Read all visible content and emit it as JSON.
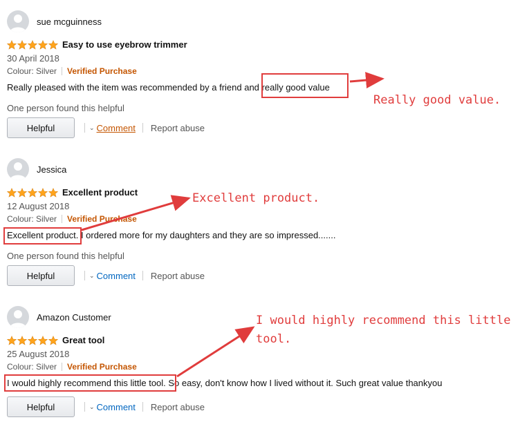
{
  "reviews": [
    {
      "reviewer": "sue mcguinness",
      "rating": 5,
      "title": "Easy to use eyebrow trimmer",
      "date": "30 April 2018",
      "colour": "Colour: Silver",
      "verified": "Verified Purchase",
      "body": "Really pleased with the item was recommended by a friend and really good value",
      "helpful_count": "One person found this helpful",
      "helpful_button": "Helpful",
      "comment": "Comment",
      "report": "Report abuse"
    },
    {
      "reviewer": "Jessica",
      "rating": 5,
      "title": "Excellent product",
      "date": "12 August 2018",
      "colour": "Colour: Silver",
      "verified": "Verified Purchase",
      "body": "Excellent product. I ordered more for my daughters and they are so impressed.......",
      "helpful_count": "One person found this helpful",
      "helpful_button": "Helpful",
      "comment": "Comment",
      "report": "Report abuse"
    },
    {
      "reviewer": "Amazon Customer",
      "rating": 5,
      "title": "Great tool",
      "date": "25 August 2018",
      "colour": "Colour: Silver",
      "verified": "Verified Purchase",
      "body": "I would highly recommend this little tool. So easy, don't know how I lived without it. Such great value thankyou",
      "helpful_count": "",
      "helpful_button": "Helpful",
      "comment": "Comment",
      "report": "Report abuse"
    }
  ],
  "annotations": {
    "a1": "Really good value.",
    "a2": "Excellent product.",
    "a3_line1": "I would highly recommend this little",
    "a3_line2": "tool."
  },
  "colors": {
    "star": "#ffa41c",
    "verified": "#c45500",
    "link": "#0066c0",
    "annotation": "#e03c3c"
  },
  "icons": [
    "avatar-icon",
    "star-icon",
    "chevron-down-icon"
  ]
}
